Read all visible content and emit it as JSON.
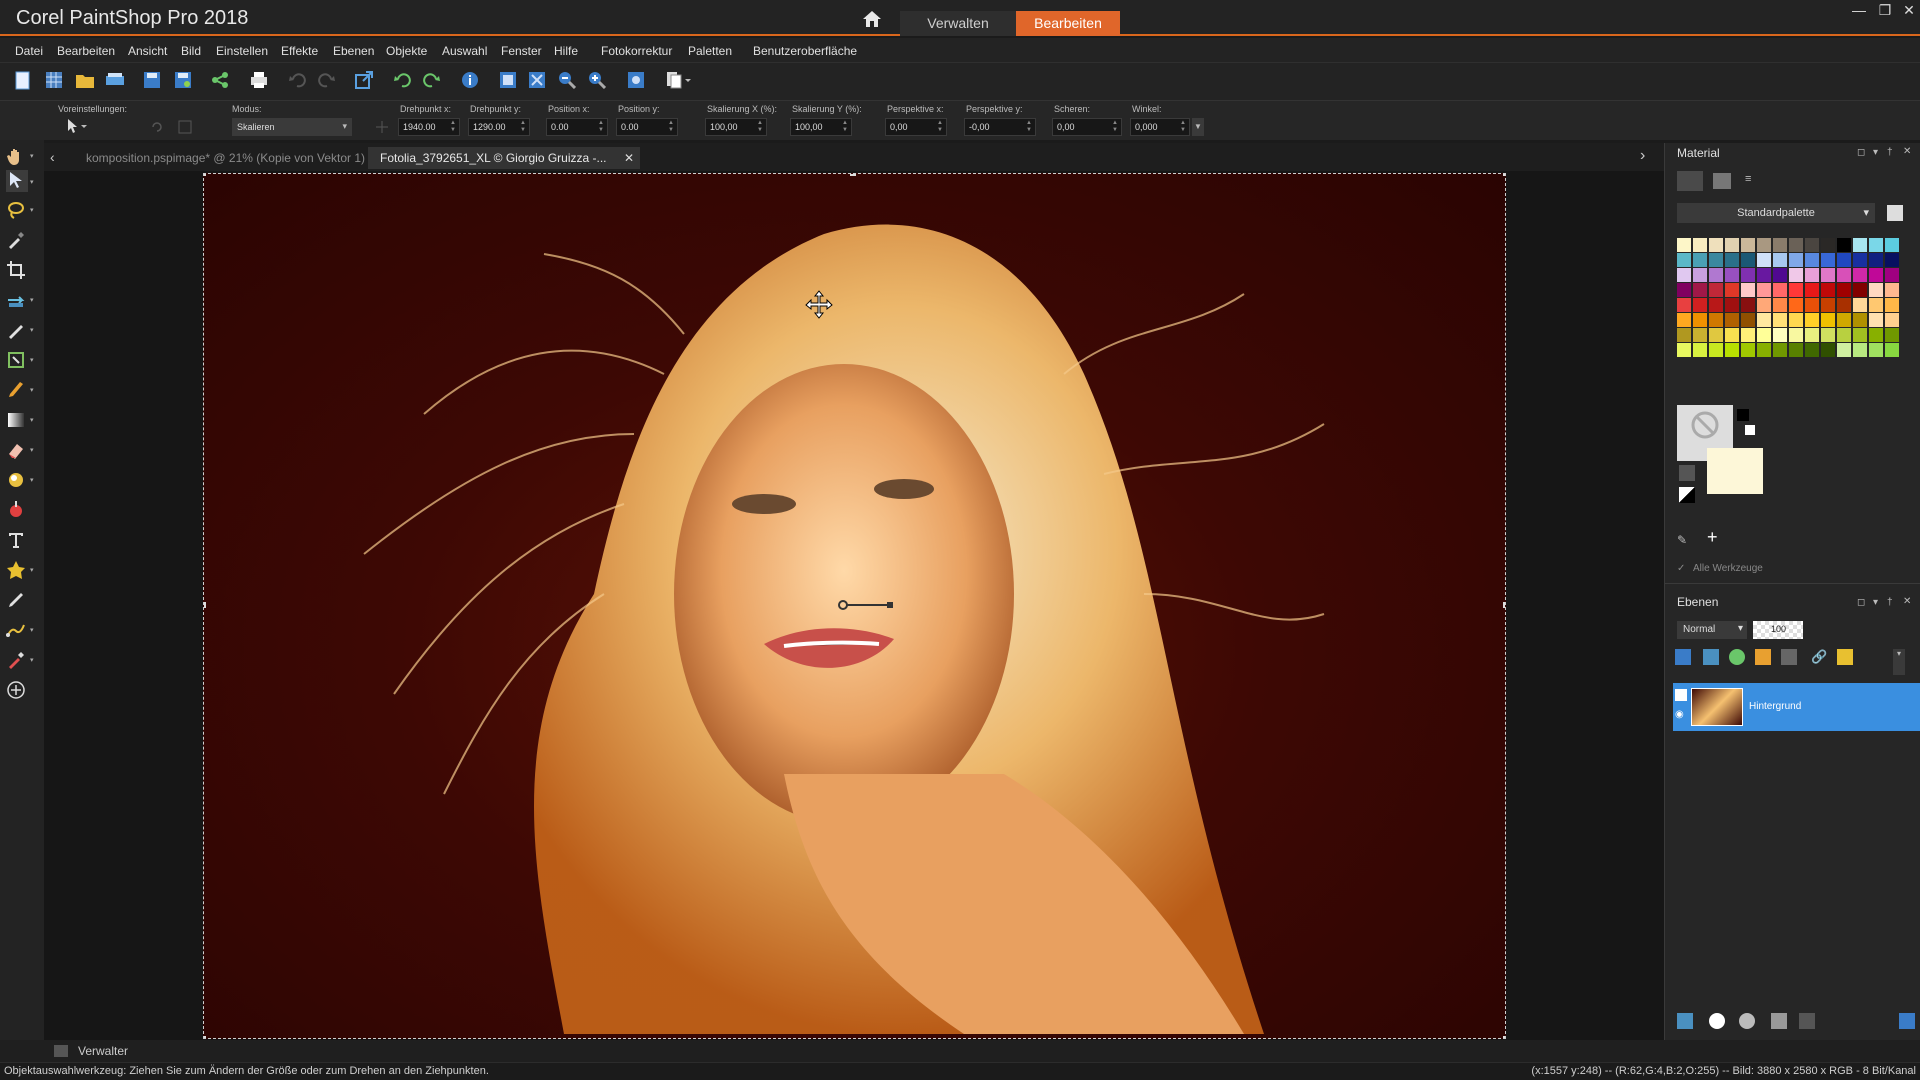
{
  "app": {
    "title": "Corel PaintShop Pro 2018"
  },
  "top_tabs": {
    "verwalten": "Verwalten",
    "bearbeiten": "Bearbeiten"
  },
  "menu": [
    "Datei",
    "Bearbeiten",
    "Ansicht",
    "Bild",
    "Einstellen",
    "Effekte",
    "Ebenen",
    "Objekte",
    "Auswahl",
    "Fenster",
    "Hilfe",
    "Fotokorrektur",
    "Paletten",
    "Benutzeroberfläche"
  ],
  "options": {
    "presets_label": "Voreinstellungen:",
    "mode_label": "Modus:",
    "mode_value": "Skalieren",
    "pivot_x_label": "Drehpunkt x:",
    "pivot_x": "1940.00",
    "pivot_y_label": "Drehpunkt y:",
    "pivot_y": "1290.00",
    "pos_x_label": "Position x:",
    "pos_x": "0.00",
    "pos_y_label": "Position y:",
    "pos_y": "0.00",
    "scale_x_label": "Skalierung X (%):",
    "scale_x": "100,00",
    "scale_y_label": "Skalierung Y (%):",
    "scale_y": "100,00",
    "persp_x_label": "Perspektive x:",
    "persp_x": "0,00",
    "persp_y_label": "Perspektive y:",
    "persp_y": "-0,00",
    "shear_label": "Scheren:",
    "shear": "0,00",
    "angle_label": "Winkel:",
    "angle": "0,000"
  },
  "doc_tabs": {
    "tab1": "komposition.pspimage* @  21% (Kopie von Vektor 1)",
    "tab2": "Fotolia_3792651_XL © Giorgio Gruizza -..."
  },
  "material": {
    "title": "Material",
    "palette": "Standardpalette",
    "all_tools": "Alle Werkzeuge"
  },
  "layers": {
    "title": "Ebenen",
    "blend_mode": "Normal",
    "opacity": "100",
    "layer_name": "Hintergrund"
  },
  "bottom": {
    "manager": "Verwalter"
  },
  "status": {
    "left": "Objektauswahlwerkzeug: Ziehen Sie zum Ändern der Größe oder zum Drehen an den Ziehpunkten.",
    "right": "(x:1557 y:248) -- (R:62,G:4,B:2,O:255) -- Bild:  3880 x 2580 x RGB - 8 Bit/Kanal"
  },
  "colors": {
    "accent": "#e0662a",
    "selected_layer": "#3a8fe0"
  },
  "swatches": [
    "#fdf6c8",
    "#f8ecc0",
    "#efe0bc",
    "#e0d1b0",
    "#cbb89a",
    "#a99881",
    "#8a7c6b",
    "#6a6157",
    "#4a4540",
    "#2a2826",
    "#000000",
    "#a8e6f0",
    "#7ad7e8",
    "#5ccde0",
    "#5bb8c8",
    "#4aa0b4",
    "#3a889f",
    "#2a708a",
    "#1a5875",
    "#d0e0f8",
    "#a8c8f0",
    "#80a8e8",
    "#5888e0",
    "#3868d8",
    "#2048c0",
    "#1830a0",
    "#102080",
    "#081060",
    "#e0c8f0",
    "#c8a0e0",
    "#b078d0",
    "#9850c0",
    "#8030b0",
    "#6818a0",
    "#500890",
    "#f0c8e8",
    "#e8a0d8",
    "#e078c8",
    "#d850b8",
    "#d028a8",
    "#c00898",
    "#a00080",
    "#800060",
    "#a01848",
    "#c02838",
    "#e03828",
    "#ffc8c8",
    "#ff9898",
    "#ff6868",
    "#ff3838",
    "#e81818",
    "#c00808",
    "#a00000",
    "#800000",
    "#ffd8c0",
    "#ffb890",
    "#e84040",
    "#d02020",
    "#b81818",
    "#a01010",
    "#881010",
    "#ffa878",
    "#ff8848",
    "#ff6818",
    "#e85008",
    "#c84000",
    "#a83000",
    "#ffd898",
    "#ffc870",
    "#ffb848",
    "#ffa820",
    "#f09000",
    "#d07800",
    "#b06000",
    "#905000",
    "#ffe8a0",
    "#ffe078",
    "#ffd850",
    "#ffd028",
    "#f0c000",
    "#d0a800",
    "#b09000",
    "#ffe0b0",
    "#ffd090",
    "#b09820",
    "#c8b030",
    "#e0c840",
    "#f8e050",
    "#fff078",
    "#ffff98",
    "#ffffc0",
    "#f8f8a0",
    "#e8f080",
    "#d0e060",
    "#b8d040",
    "#a0c020",
    "#88b000",
    "#709800",
    "#e8f860",
    "#d8f040",
    "#c8e820",
    "#b8e000",
    "#a0c800",
    "#88b000",
    "#709800",
    "#588000",
    "#406800",
    "#305000",
    "#d0f0a0",
    "#b8e880",
    "#a0e060",
    "#88d840"
  ]
}
